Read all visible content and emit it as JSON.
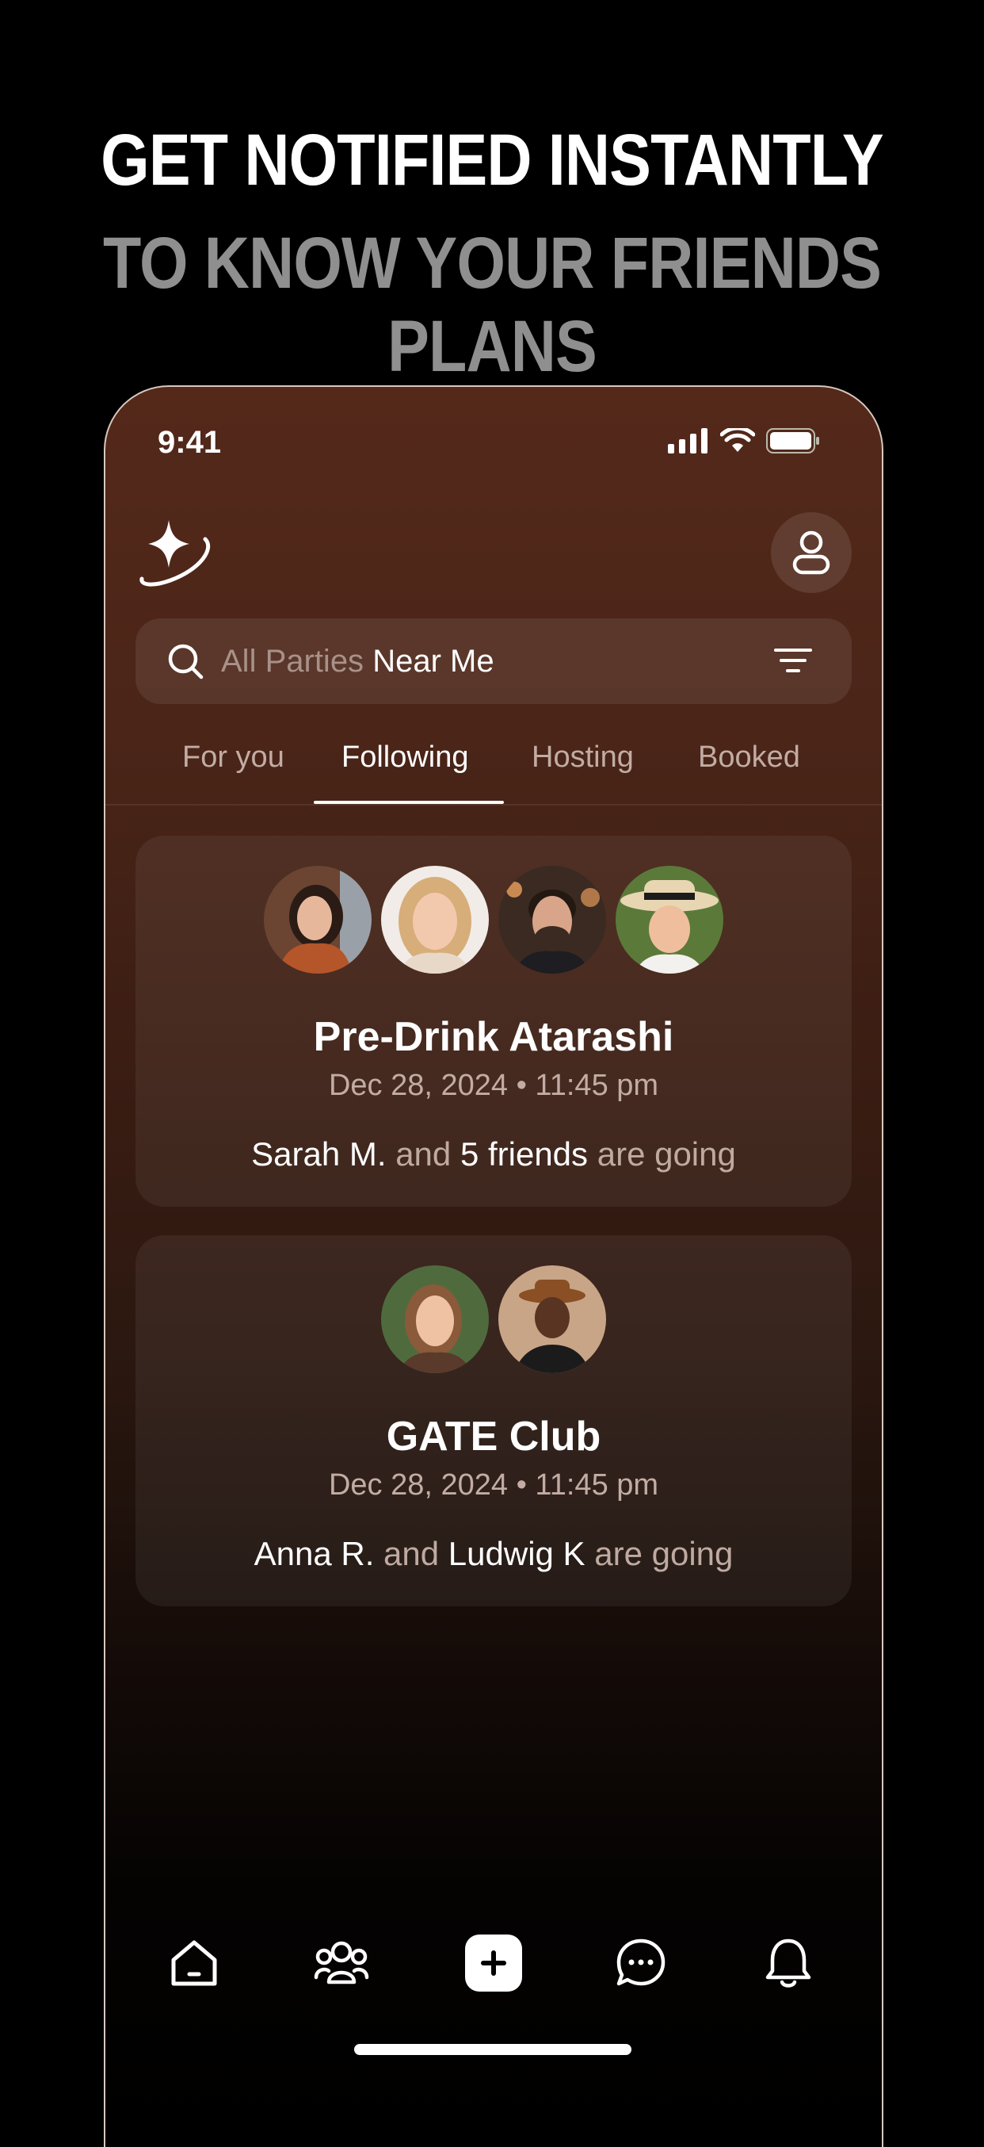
{
  "headline": {
    "line1": "GET NOTIFIED INSTANTLY",
    "line2": "TO KNOW YOUR FRIENDS PLANS"
  },
  "status_bar": {
    "time": "9:41",
    "icons": [
      "signal-icon",
      "wifi-icon",
      "battery-icon"
    ]
  },
  "header": {
    "logo_icon": "sparkle-logo-icon",
    "profile_icon": "user-icon"
  },
  "search": {
    "icon": "search-icon",
    "prefix": "All Parties",
    "suffix": "Near Me",
    "filter_icon": "filter-icon"
  },
  "tabs": [
    {
      "label": "For you",
      "active": false
    },
    {
      "label": "Following",
      "active": true
    },
    {
      "label": "Hosting",
      "active": false
    },
    {
      "label": "Booked",
      "active": false
    }
  ],
  "events": [
    {
      "title": "Pre-Drink Atarashi",
      "datetime": "Dec 28, 2024 • 11:45 pm",
      "going": {
        "name": "Sarah M.",
        "joiner": "and",
        "others": "5 friends",
        "suffix": "are going"
      },
      "avatar_count": 4
    },
    {
      "title": "GATE Club",
      "datetime": "Dec 28, 2024 • 11:45 pm",
      "going": {
        "name": "Anna R.",
        "joiner": "and",
        "others": "Ludwig K",
        "suffix": "are going"
      },
      "avatar_count": 2
    }
  ],
  "bottom_nav": [
    "home-icon",
    "friends-icon",
    "add-icon",
    "chat-icon",
    "bell-icon"
  ],
  "colors": {
    "background": "#000000",
    "phone_top": "#54291a",
    "phone_bottom": "#000000",
    "headline_secondary": "#8f8f8f",
    "muted_text": "#c2aca3"
  }
}
